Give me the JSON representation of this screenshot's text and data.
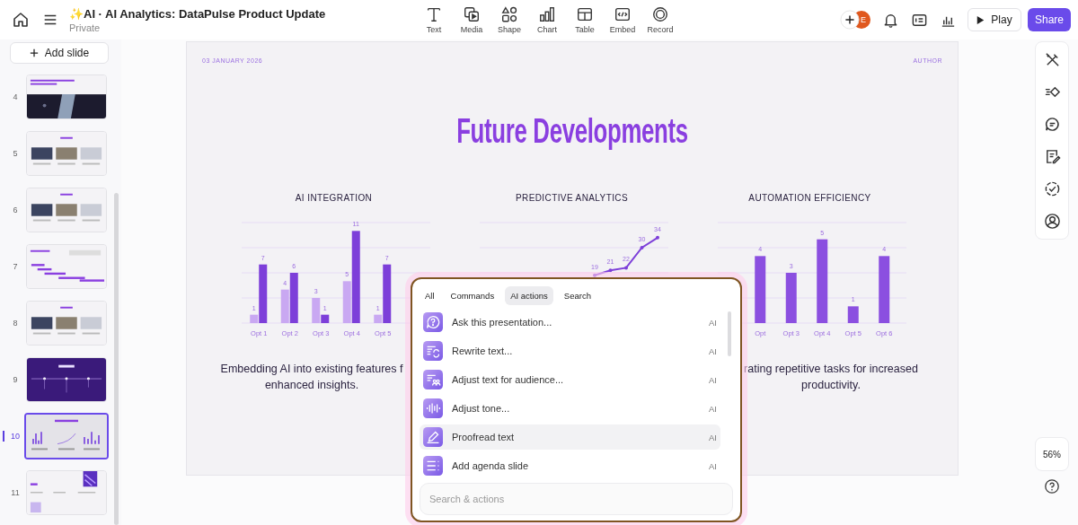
{
  "topbar": {
    "title": "✨AI · AI Analytics: DataPulse Product Update",
    "subtitle": "Private",
    "tools": [
      {
        "label": "Text",
        "kind": "text"
      },
      {
        "label": "Media",
        "kind": "media"
      },
      {
        "label": "Shape",
        "kind": "shape"
      },
      {
        "label": "Chart",
        "kind": "chart"
      },
      {
        "label": "Table",
        "kind": "table"
      },
      {
        "label": "Embed",
        "kind": "embed"
      },
      {
        "label": "Record",
        "kind": "record"
      }
    ],
    "avatar_initial": "E",
    "play": "Play",
    "share": "Share"
  },
  "sidebar": {
    "add_slide": "Add slide",
    "slides": [
      {
        "number": "4",
        "kind": "banner",
        "selected": false
      },
      {
        "number": "5",
        "kind": "photos",
        "selected": false
      },
      {
        "number": "6",
        "kind": "photos",
        "selected": false
      },
      {
        "number": "7",
        "kind": "gantt",
        "selected": false
      },
      {
        "number": "8",
        "kind": "photos",
        "selected": false
      },
      {
        "number": "9",
        "kind": "dark",
        "selected": false
      },
      {
        "number": "10",
        "kind": "charts",
        "selected": true
      },
      {
        "number": "11",
        "kind": "contact",
        "selected": false
      }
    ]
  },
  "slide": {
    "date": "03 JANUARY 2026",
    "author": "AUTHOR",
    "title": "Future Developments",
    "columns": [
      {
        "heading": "AI INTEGRATION",
        "description": [
          "Embedding AI into existing features f",
          "enhanced insights."
        ],
        "chart_data": {
          "type": "bar",
          "categories": [
            "Opt 1",
            "Opt 2",
            "Opt 3",
            "Opt 4",
            "Opt 5"
          ],
          "ylim": [
            0,
            12
          ],
          "data_labels": true,
          "series": [
            {
              "color": "#c9a8f2",
              "values": [
                1,
                4,
                3,
                5,
                1
              ]
            },
            {
              "color": "#7d3fd9",
              "values": [
                7,
                6,
                1,
                11,
                7
              ]
            }
          ]
        }
      },
      {
        "heading": "PREDICTIVE ANALYTICS",
        "chart_data": {
          "type": "line",
          "ylim": [
            0,
            40
          ],
          "data_labels": true,
          "series": [
            {
              "color": "#7d3fd9",
              "values": [
                19,
                21,
                22,
                30,
                34
              ]
            }
          ]
        }
      },
      {
        "heading": "AUTOMATION EFFICIENCY",
        "description": [
          "rating repetitive tasks for increased",
          "productivity."
        ],
        "chart_data": {
          "type": "bar",
          "categories": [
            "Opt",
            "Opt 3",
            "Opt 4",
            "Opt 5",
            "Opt 6"
          ],
          "ylim": [
            0,
            6
          ],
          "data_labels": true,
          "series": [
            {
              "color": "#8b4fe0",
              "values": [
                4,
                3,
                5,
                1,
                4
              ]
            }
          ]
        }
      }
    ]
  },
  "palette": {
    "tabs": [
      {
        "label": "All",
        "selected": false
      },
      {
        "label": "Commands",
        "selected": false
      },
      {
        "label": "AI actions",
        "selected": true
      },
      {
        "label": "Search",
        "selected": false
      }
    ],
    "items": [
      {
        "label": "Ask this presentation...",
        "kind": "ask",
        "tag": "AI",
        "highlighted": false
      },
      {
        "label": "Rewrite text...",
        "kind": "rewrite",
        "tag": "AI",
        "highlighted": false
      },
      {
        "label": "Adjust text for audience...",
        "kind": "audience",
        "tag": "AI",
        "highlighted": false
      },
      {
        "label": "Adjust tone...",
        "kind": "tone",
        "tag": "AI",
        "highlighted": false
      },
      {
        "label": "Proofread text",
        "kind": "proofread",
        "tag": "AI",
        "highlighted": true
      },
      {
        "label": "Add agenda slide",
        "kind": "agenda",
        "tag": "AI",
        "highlighted": false
      }
    ],
    "search": {
      "placeholder": "Search & actions"
    }
  },
  "zoom": "56%"
}
